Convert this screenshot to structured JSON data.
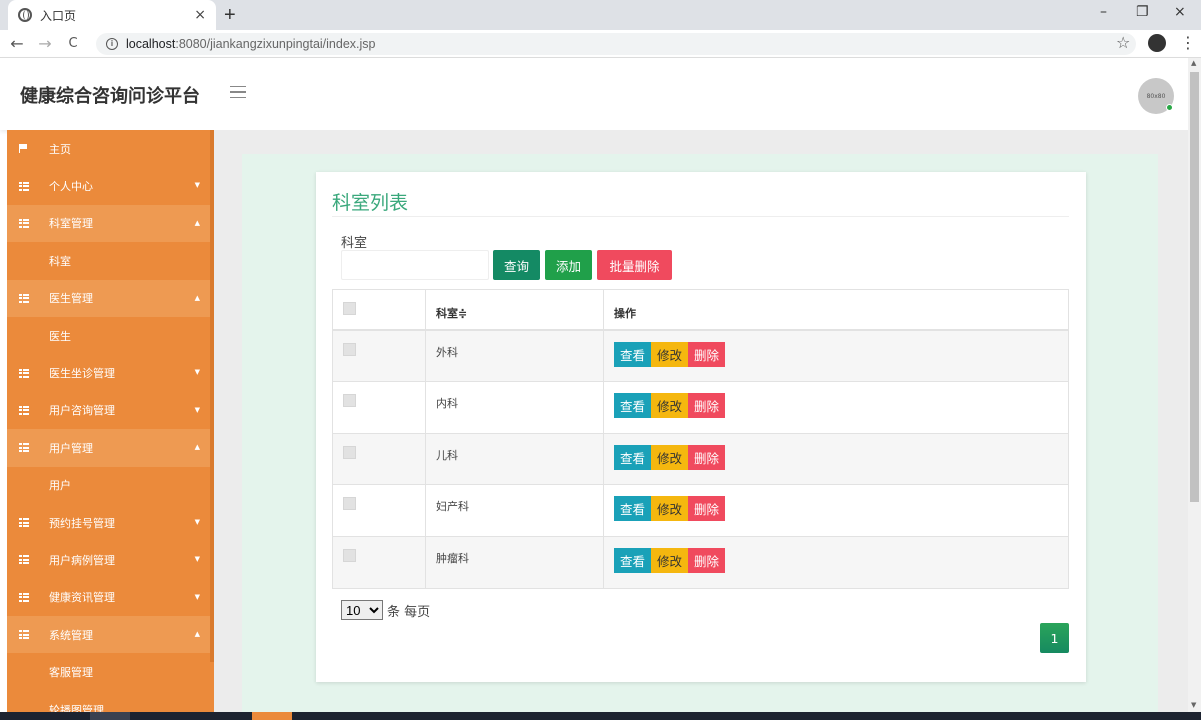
{
  "browser": {
    "tab_title": "入口页",
    "tab_close": "×",
    "new_tab": "+",
    "win_min": "–",
    "win_restore": "❐",
    "win_close": "×",
    "back": "←",
    "forward": "→",
    "reload": "C",
    "url_host": "localhost",
    "url_path": ":8080/jiankangzixunpingtai/index.jsp",
    "star": "☆",
    "menu": "⋮"
  },
  "header": {
    "brand": "健康综合咨询问诊平台",
    "avatar_text": "80x80"
  },
  "sidebar": {
    "items": [
      {
        "label": "主页",
        "icon": "flag-icon",
        "caret": ""
      },
      {
        "label": "个人中心",
        "icon": "grid-icon",
        "caret": "▼"
      },
      {
        "label": "科室管理",
        "icon": "grid-icon",
        "caret": "▲"
      },
      {
        "label": "科室",
        "sub": true
      },
      {
        "label": "医生管理",
        "icon": "grid-icon",
        "caret": "▲"
      },
      {
        "label": "医生",
        "sub": true
      },
      {
        "label": "医生坐诊管理",
        "icon": "grid-icon",
        "caret": "▼"
      },
      {
        "label": "用户咨询管理",
        "icon": "grid-icon",
        "caret": "▼"
      },
      {
        "label": "用户管理",
        "icon": "grid-icon",
        "caret": "▲"
      },
      {
        "label": "用户",
        "sub": true
      },
      {
        "label": "预约挂号管理",
        "icon": "grid-icon",
        "caret": "▼"
      },
      {
        "label": "用户病例管理",
        "icon": "grid-icon",
        "caret": "▼"
      },
      {
        "label": "健康资讯管理",
        "icon": "grid-icon",
        "caret": "▼"
      },
      {
        "label": "系统管理",
        "icon": "grid-icon",
        "caret": "▲"
      },
      {
        "label": "客服管理",
        "sub": true
      },
      {
        "label": "轮播图管理",
        "sub": true
      }
    ]
  },
  "main": {
    "title": "科室列表",
    "search_label": "科室",
    "search_value": "",
    "btn_search": "查询",
    "btn_add": "添加",
    "btn_batch_delete": "批量删除",
    "table": {
      "headers": [
        "",
        "科室≑",
        "操作"
      ],
      "rows": [
        "外科",
        "内科",
        "儿科",
        "妇产科",
        "肿瘤科"
      ],
      "action_view": "查看",
      "action_edit": "修改",
      "action_delete": "删除"
    },
    "page_size": "10",
    "page_size_suffix": "条 每页",
    "current_page": "1"
  }
}
